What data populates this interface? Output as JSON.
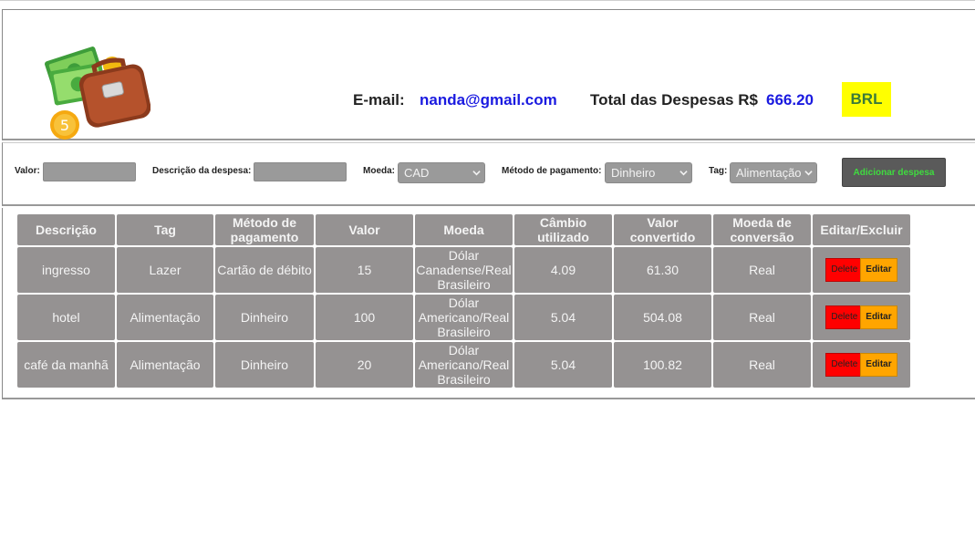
{
  "header": {
    "email_label": "E-mail:",
    "email": "nanda@gmail.com",
    "total_label": "Total das Despesas R$",
    "total": "666.20",
    "currency": "BRL"
  },
  "form": {
    "valor_label": "Valor:",
    "descricao_label": "Descrição da despesa:",
    "moeda_label": "Moeda:",
    "moeda_value": "CAD",
    "metodo_label": "Método de pagamento:",
    "metodo_value": "Dinheiro",
    "tag_label": "Tag:",
    "tag_value": "Alimentação",
    "add_button": "Adicionar despesa"
  },
  "table": {
    "headers": [
      "Descrição",
      "Tag",
      "Método de pagamento",
      "Valor",
      "Moeda",
      "Câmbio utilizado",
      "Valor convertido",
      "Moeda de conversão",
      "Editar/Excluir"
    ],
    "rows": [
      {
        "descricao": "ingresso",
        "tag": "Lazer",
        "metodo": "Cartão de débito",
        "valor": "15",
        "moeda": "Dólar Canadense/Real Brasileiro",
        "cambio": "4.09",
        "convertido": "61.30",
        "conversao": "Real"
      },
      {
        "descricao": "hotel",
        "tag": "Alimentação",
        "metodo": "Dinheiro",
        "valor": "100",
        "moeda": "Dólar Americano/Real Brasileiro",
        "cambio": "5.04",
        "convertido": "504.08",
        "conversao": "Real"
      },
      {
        "descricao": "café da manhã",
        "tag": "Alimentação",
        "metodo": "Dinheiro",
        "valor": "20",
        "moeda": "Dólar Americano/Real Brasileiro",
        "cambio": "5.04",
        "convertido": "100.82",
        "conversao": "Real"
      }
    ],
    "delete_label": "Delete",
    "edit_label": "Editar"
  },
  "icons": {
    "logo": "wallet-money-icon",
    "dropdown": "chevron-down-icon"
  },
  "colors": {
    "accent_blue": "#1a1ae0",
    "currency_bg": "#ffff00",
    "cell_bg": "#959292",
    "delete_bg": "#ff0000",
    "edit_bg": "#ffa500",
    "add_text": "#3fdc3f"
  }
}
